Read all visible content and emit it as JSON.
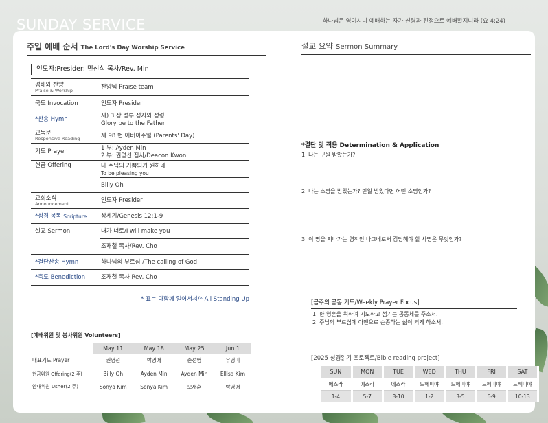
{
  "header": {
    "title": "SUNDAY SERVICE",
    "verse": "하나님은 영이시니 예배하는 자가 신령과 진정으로 예배할지니라 (요 4:24)"
  },
  "left": {
    "section_ko": "주일 예배 순서",
    "section_en": "The Lord's Day Worship Service",
    "presider": "인도자:Presider: 민선식 목사/Rev. Min",
    "order": [
      {
        "label": "경배와 찬양",
        "sub": "Praise & Worship",
        "value": "찬양팀 Praise team"
      },
      {
        "label": "묵도 Invocation",
        "value": "인도자 Presider"
      },
      {
        "label": "*찬송 Hymn",
        "value": "새) 3 장 성부 성자와 성령",
        "value2": "Glory be to the Father"
      },
      {
        "label": "교독문",
        "sub": "Responsive Reading",
        "value": "제 98 번 어버이주일 (Parents' Day)"
      },
      {
        "label": "기도 Prayer",
        "value": "1 부: Ayden Min",
        "value2": "2 부: 권영선 집사/Deacon Kwon"
      },
      {
        "label": "헌금 Offering",
        "value": "나 주님의 기쁨되기 원하네",
        "value2": "To be pleasing you"
      },
      {
        "label": "",
        "value": "Billy Oh"
      },
      {
        "label": "교회소식",
        "sub": "Announcement",
        "value": "인도자 Presider"
      },
      {
        "label": "*성경 봉독",
        "label_en": "Scripture",
        "value": "창세기/Genesis 12:1-9"
      },
      {
        "label": "설교 Sermon",
        "value": "내가 너로/I will make you"
      },
      {
        "label": "",
        "value": "조재철 목사/Rev. Cho"
      },
      {
        "label": "*결단찬송 Hymn",
        "value": "하나님의 부르심 /The calling of God"
      },
      {
        "label": "*축도 Benediction",
        "value": "조재철 목사 Rev. Cho"
      }
    ],
    "standing_note": "* 표는 다함께 일어서서/* All Standing Up",
    "volunteers": {
      "title": "[예배위원 및 봉사위원 Volunteers]",
      "dates": [
        "May 11",
        "May 18",
        "May 25",
        "Jun 1"
      ],
      "rows": [
        {
          "role": "대표기도 Prayer",
          "names": [
            "권영선",
            "박영애",
            "손선영",
            "유영미"
          ]
        },
        {
          "role": "헌금위원 Offering(2 주)",
          "names": [
            "Billy Oh",
            "Ayden Min",
            "Ayden Min",
            "Ellisa Kim"
          ]
        },
        {
          "role": "안내위원 Usher(2 주)",
          "names": [
            "Sonya Kim",
            "Sonya Kim",
            "오재훈",
            "박영애"
          ]
        }
      ]
    }
  },
  "right": {
    "section_ko": "설교 요약",
    "section_en": "Sermon Summary",
    "decision_title": "*결단 및 적용 Determination & Application",
    "questions": [
      "1. 나는 구원 받았는가?",
      "2. 나는 소명을 받았는가? 만일 받았다면 어떤 소명인가?",
      "3. 이 땅을 지나가는 영적인 나그네로서 감당해야 할 사명은 무엇인가?"
    ],
    "prayer": {
      "title": "[금주의 공동 기도/Weekly Prayer Focus]",
      "items": [
        "1. 한 영혼을 위하여 기도하고 섬기는 공동체를 주소서.",
        "2. 주님의 부르심에 아멘으로 순종하는 삶이 되게 하소서."
      ]
    },
    "bible": {
      "title": "[2025 성경읽기 프로젝트/Bible reading project]",
      "days": [
        "SUN",
        "MON",
        "TUE",
        "WED",
        "THU",
        "FRI",
        "SAT"
      ],
      "books": [
        "에스라",
        "에스라",
        "에스라",
        "느헤미야",
        "느헤미야",
        "느헤미야",
        "느헤미야"
      ],
      "chapters": [
        "1-4",
        "5-7",
        "8-10",
        "1-2",
        "3-5",
        "6-9",
        "10-13"
      ]
    }
  }
}
